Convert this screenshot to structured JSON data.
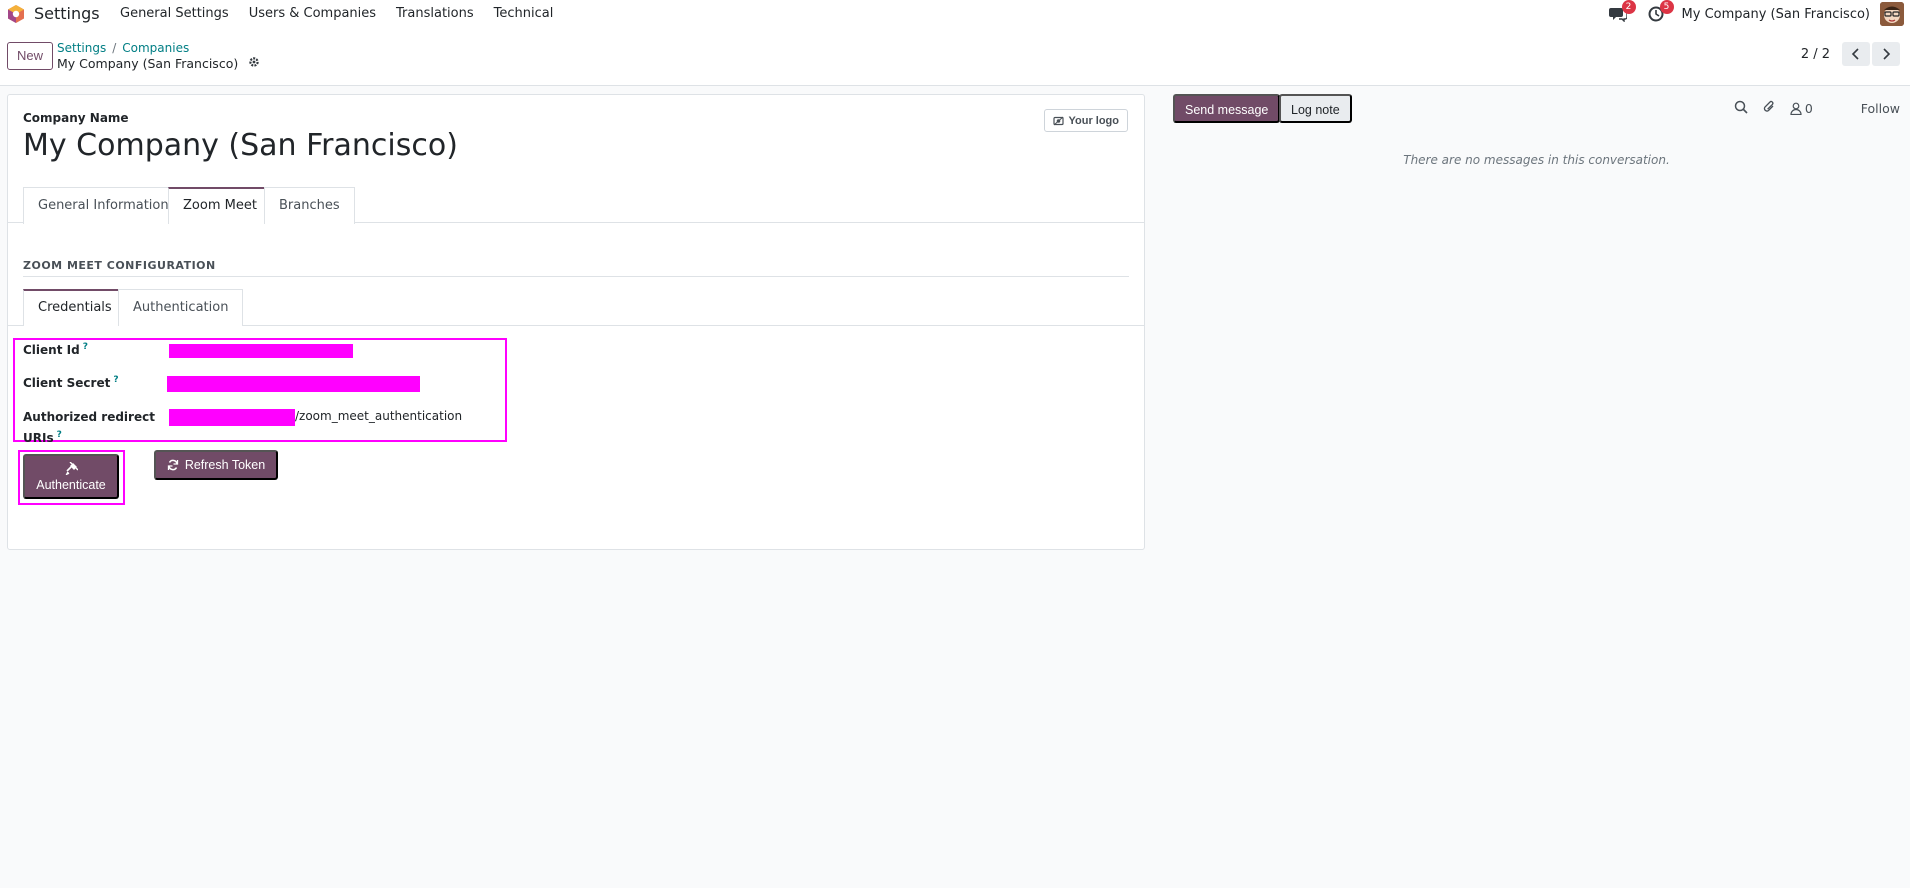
{
  "navbar": {
    "app_name": "Settings",
    "menu": [
      "General Settings",
      "Users & Companies",
      "Translations",
      "Technical"
    ],
    "messages_badge": "2",
    "activities_badge": "5",
    "company_switcher": "My Company (San Francisco)"
  },
  "control_panel": {
    "new_label": "New",
    "breadcrumb": [
      "Settings",
      "Companies"
    ],
    "record_title": "My Company (San Francisco)",
    "pager_value": "2 / 2"
  },
  "form": {
    "company_name_label": "Company Name",
    "company_name": "My Company (San Francisco)",
    "logo_button": "Your logo",
    "tabs": [
      "General Information",
      "Zoom Meet",
      "Branches"
    ],
    "active_tab": "Zoom Meet",
    "section_title": "ZOOM MEET CONFIGURATION",
    "subtabs": [
      "Credentials",
      "Authentication"
    ],
    "active_subtab": "Credentials",
    "fields": {
      "client_id_label": "Client Id",
      "client_secret_label": "Client Secret",
      "redirect_label_line1": "Authorized redirect",
      "redirect_label_line2": "URIs",
      "help_mark": "?",
      "redirect_suffix": "/zoom_meet_authentication"
    },
    "authenticate_label": "Authenticate",
    "refresh_token_label": "Refresh Token"
  },
  "chatter": {
    "send_message": "Send message",
    "log_note": "Log note",
    "followers_count": "0",
    "follow_label": "Follow",
    "empty_message": "There are no messages in this conversation."
  },
  "colors": {
    "brand": "#714b67",
    "link": "#017e84",
    "highlight": "#ff00ff",
    "badge": "#dc3545"
  }
}
